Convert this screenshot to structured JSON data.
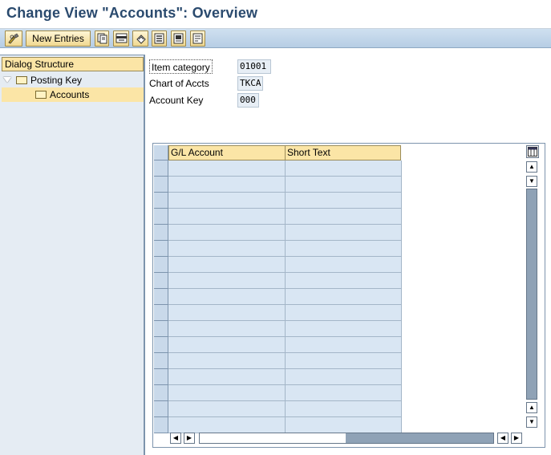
{
  "title": "Change View \"Accounts\": Overview",
  "toolbar": {
    "new_entries_label": "New Entries",
    "icons": [
      "display-change-icon",
      "copy-icon",
      "delete-icon",
      "undo-icon",
      "select-all-icon",
      "select-block-icon",
      "deselect-all-icon"
    ]
  },
  "dialog_structure": {
    "header": "Dialog Structure",
    "items": [
      {
        "label": "Posting Key",
        "expanded": true
      },
      {
        "label": "Accounts",
        "selected": true
      }
    ]
  },
  "fields": [
    {
      "label": "Item category",
      "value": "01001"
    },
    {
      "label": "Chart of Accts",
      "value": "TKCA"
    },
    {
      "label": "Account Key",
      "value": "000"
    }
  ],
  "table": {
    "columns": [
      "G/L Account",
      "Short Text"
    ],
    "rows": 17
  },
  "colors": {
    "header_fill": "#fbe5a6",
    "cell_fill": "#d9e6f3",
    "title_text": "#2a4a6e"
  }
}
